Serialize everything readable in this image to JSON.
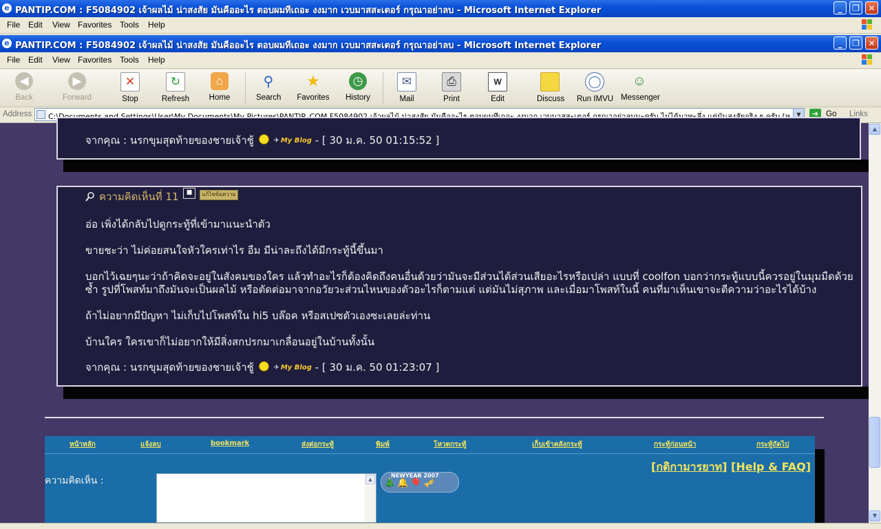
{
  "windows": [
    {
      "title": "PANTIP.COM : F5084902 เจ้าผลไม้ น่าสงสัย มันคืออะไร ตอบผมทีเถอะ งงมาก เวบมาสสะเตอร์ กรุณาอย่าลบ - Microsoft Internet Explorer"
    },
    {
      "title": "PANTIP.COM : F5084902 เจ้าผลไม้ น่าสงสัย มันคืออะไร ตอบผมทีเถอะ งงมาก เวบมาสสะเตอร์ กรุณาอย่าลบ - Microsoft Internet Explorer"
    }
  ],
  "window_controls": {
    "minimize": "_",
    "restore": "❐",
    "close": "✕"
  },
  "menu": [
    "File",
    "Edit",
    "View",
    "Favorites",
    "Tools",
    "Help"
  ],
  "toolbar": {
    "back": "Back",
    "forward": "Forward",
    "stop": "Stop",
    "refresh": "Refresh",
    "home": "Home",
    "search": "Search",
    "favorites": "Favorites",
    "history": "History",
    "mail": "Mail",
    "print": "Print",
    "edit": "Edit",
    "discuss": "Discuss",
    "run_imvu": "Run IMVU",
    "messenger": "Messenger"
  },
  "address": {
    "label": "Address",
    "url": "C:\\Documents and Settings\\User\\My Documents\\My Pictures\\PANTIP_COM  F5084902 เจ้าผลไม้ น่าสงสัย มันคืออะไร ตอบผมทีเถอะ งงมาก เวบมาสสะเตอร์ กรุณาอย่าลบนะครับ ไม่ได้มาทะลึ่ง แต่มันสงสัยจริง ๆ ครับ [หลังห้องสยาม].htm",
    "go": "Go",
    "links": "Links"
  },
  "post_prev": {
    "sig_prefix": "จากคุณ : นรกขุมสุดท้ายของชายเจ้าชู้",
    "blog_badge": "My Blog",
    "timestamp": "- [ 30 ม.ค. 50 01:15:52 ]"
  },
  "comment": {
    "heading": "ความคิดเห็นที่ 11",
    "edit_button": "แก้ไขข้อความ",
    "paragraphs": [
      "อ่อ เพิ่งได้กลับไปดูกระทู้ที่เข้ามาแนะนำตัว",
      "ขายชะว่า ไม่ค่อยสนใจหัวใครเท่าไร อืม มีน่าละถึงได้มีกระทู้นี้ขึ้นมา",
      "บอกไว้เฉยๆนะว่าถ้าคิดจะอยู่ในสังคมของใคร แล้วทำอะไรก็ต้องคิดถึงคนอื่นด้วยว่ามันจะมีส่วนได้ส่วนเสียอะไรหรือเปล่า แบบที่ coolfon บอกว่ากระทู้แบบนี้ควรอยู่ในมุมมืดด้วย",
      "ซ้ำ รูปที่โพสท์มาถึงมันจะเป็นผลไม้ หรือตัดต่อมาจากอวัยวะส่วนไหนของตัวอะไรก็ตามแต่ แต่มันไม่สุภาพ และเมื่อมาโพสท์ในนี้ คนที่มาเห็นเขาจะตีความว่าอะไรได้บ้าง",
      "ถ้าไม่อยากมีปัญหา ไม่เก็บไปโพสท์ใน hi5 บล๊อค หรือสเปซตัวเองซะเลยล่ะท่าน",
      "บ้านใคร ใครเขาก็ไม่อยากให้มีสิ่งสกปรกมาเกลื่อนอยู่ในบ้านทั้งนั้น"
    ],
    "sig_prefix": "จากคุณ : นรกขุมสุดท้ายของชายเจ้าชู้",
    "blog_badge": "My Blog",
    "timestamp": "- [ 30 ม.ค. 50 01:23:07 ]"
  },
  "navbar": [
    "หน้าหลัก",
    "แจ้งลบ",
    "bookmark",
    "ส่งต่อกระทู้",
    "พิมพ์",
    "โหวตกระทู้",
    "เก็บเข้าคลังกระทู้",
    "กระทู้ก่อนหน้า",
    "กระทู้ถัดไป"
  ],
  "help": {
    "rules": "กติกามารยาท",
    "faq": "Help & FAQ"
  },
  "reply": {
    "label": "ความคิดเห็น :",
    "badge": "NEWYEAR 2007"
  }
}
